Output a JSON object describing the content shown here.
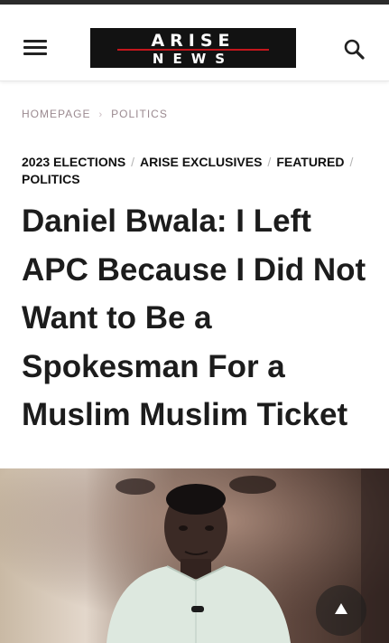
{
  "header": {
    "menu_icon": "hamburger-menu-icon",
    "logo": {
      "line1": "ARISE",
      "line2": "NEWS"
    },
    "search_icon": "search-icon"
  },
  "breadcrumb": {
    "items": [
      "HOMEPAGE",
      "POLITICS"
    ],
    "separator": "›"
  },
  "article": {
    "categories": [
      "2023 ELECTIONS",
      "ARISE EXCLUSIVES",
      "FEATURED",
      "POLITICS"
    ],
    "category_separator": "/",
    "headline": "Daniel Bwala: I Left APC Because I Did Not Want to Be a Spokesman For a Muslim Muslim Ticket"
  },
  "scroll_top": {
    "icon": "scroll-to-top-icon",
    "glyph": "▲"
  },
  "colors": {
    "logo_background": "#121212",
    "logo_accent": "#c4161c",
    "breadcrumb_text": "#9b8a90",
    "headline_text": "#1c1c1c"
  }
}
